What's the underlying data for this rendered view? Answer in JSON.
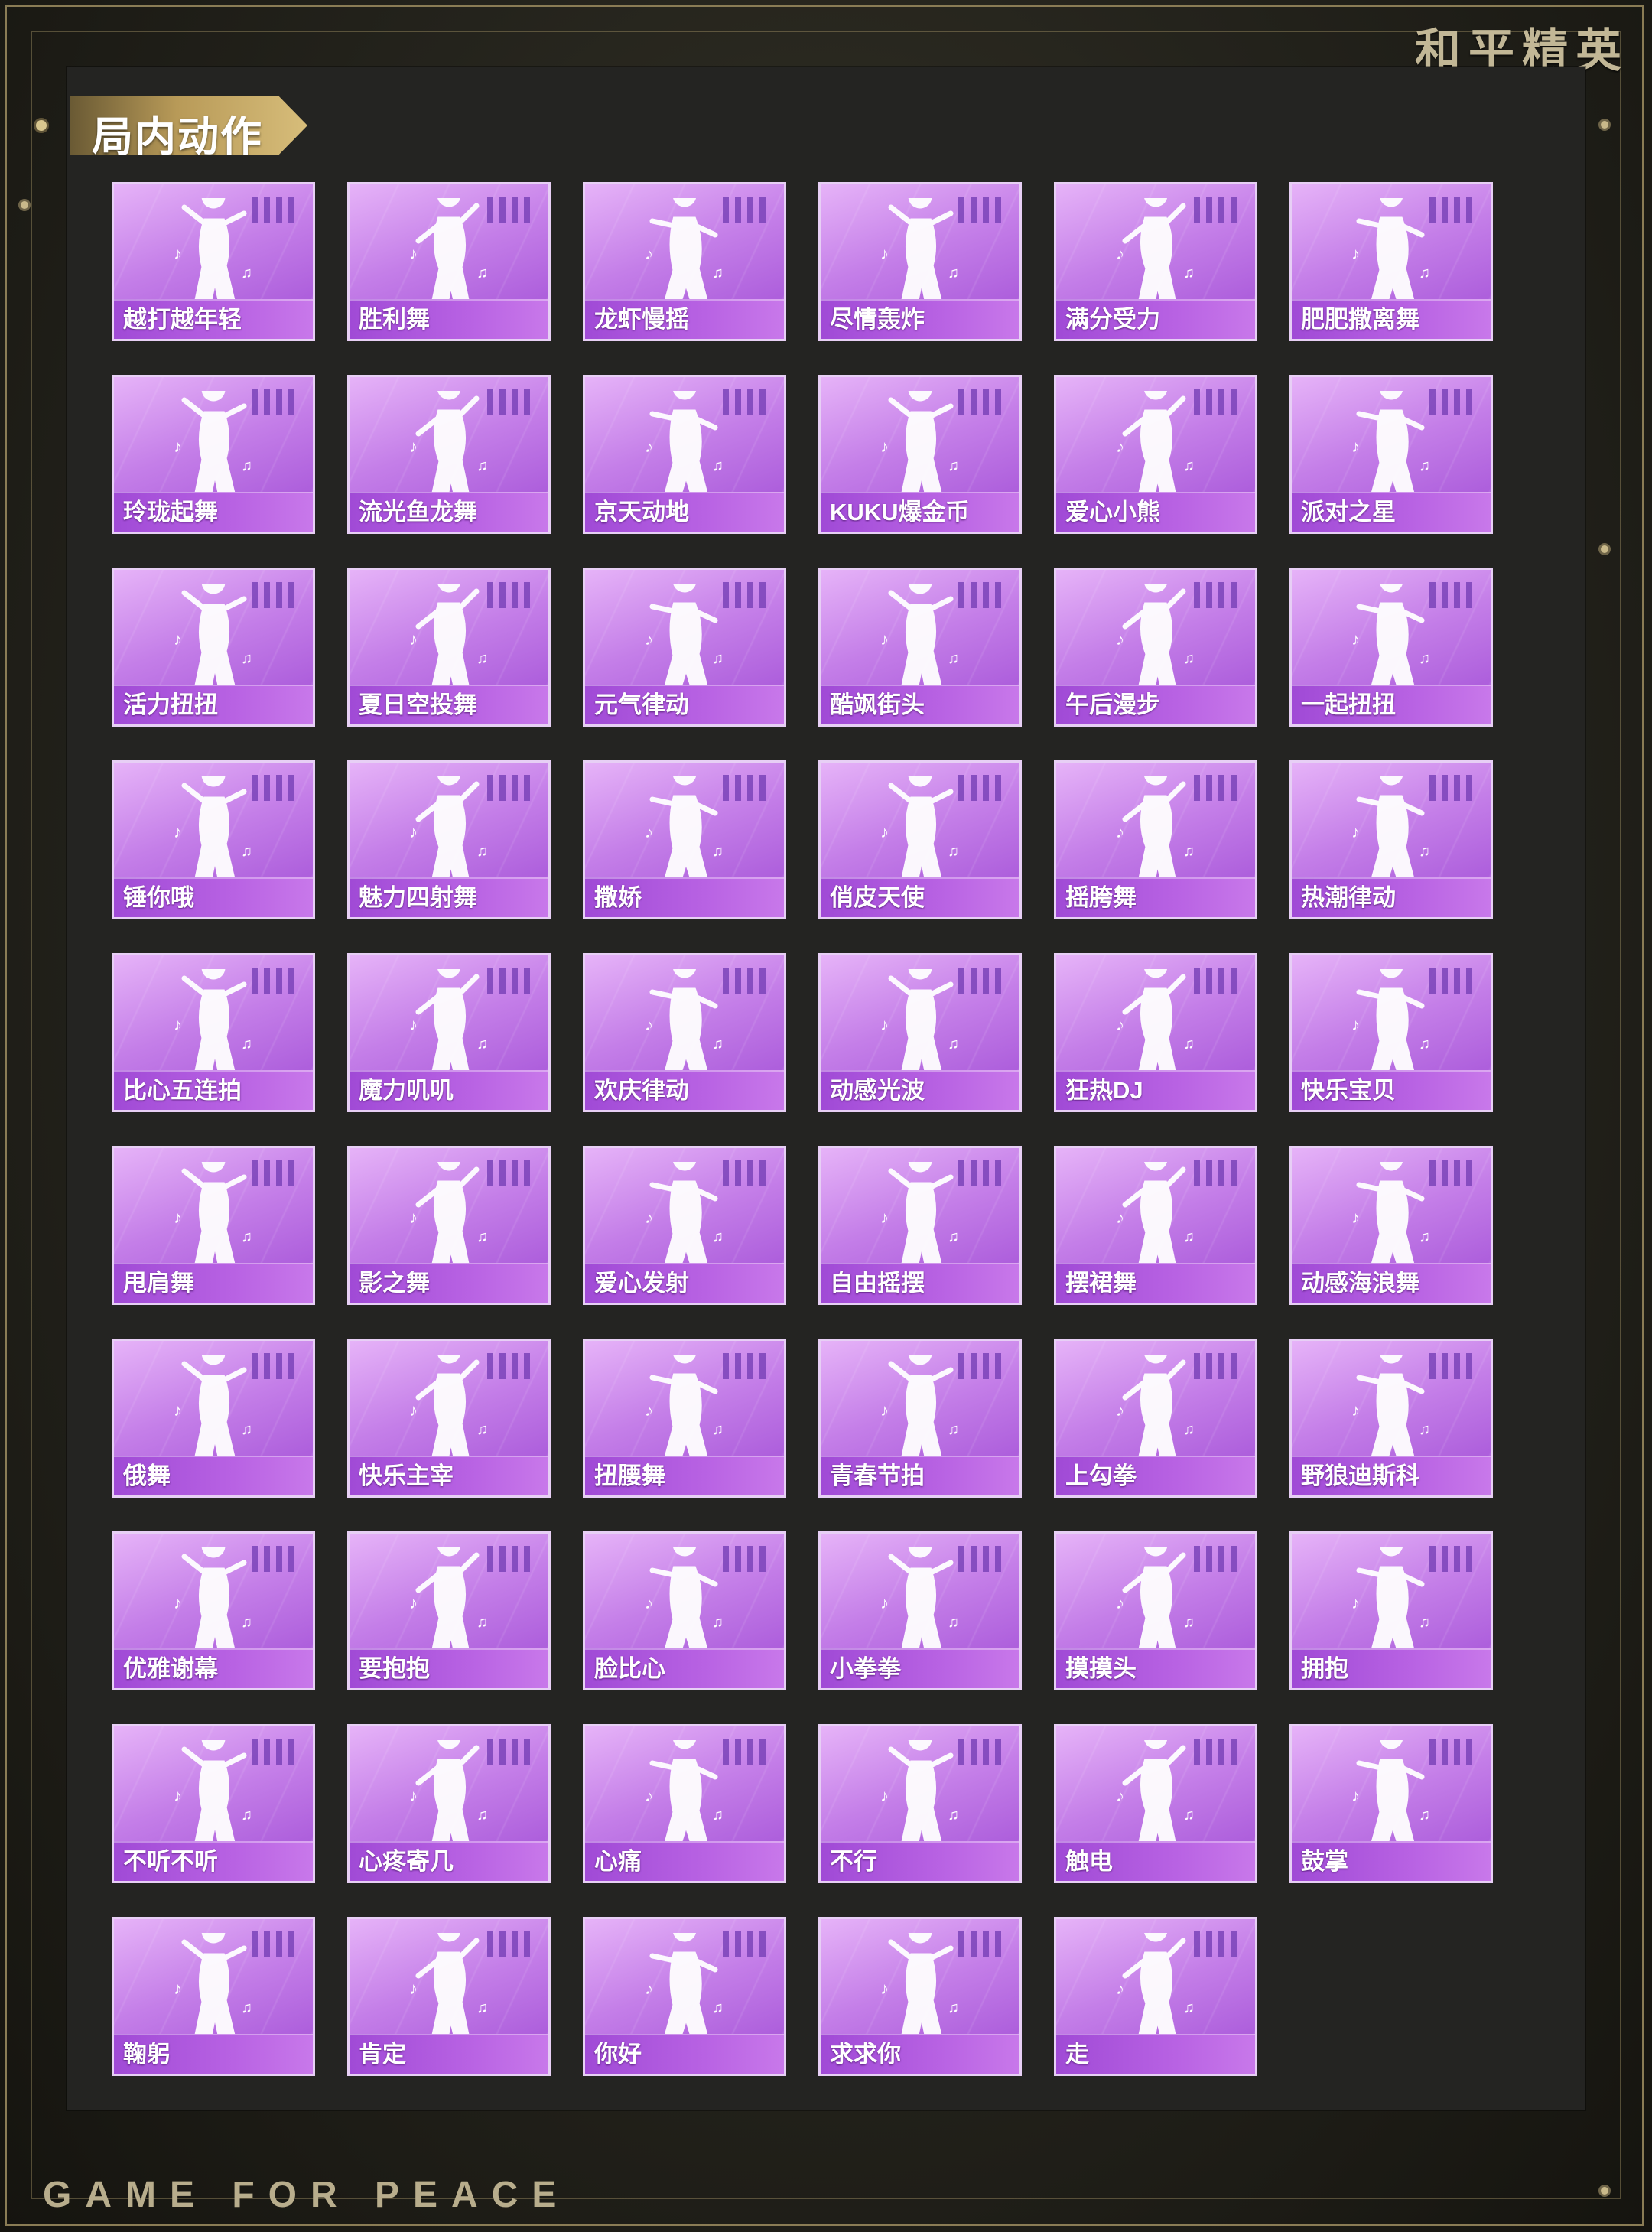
{
  "brand": {
    "top_text": "和平精英",
    "bottom_text": "GAME FOR PEACE"
  },
  "section": {
    "title": "局内动作"
  },
  "emotes": [
    {
      "name": "越打越年轻"
    },
    {
      "name": "胜利舞"
    },
    {
      "name": "龙虾慢摇"
    },
    {
      "name": "尽情轰炸"
    },
    {
      "name": "满分受力"
    },
    {
      "name": "肥肥撒离舞"
    },
    {
      "name": "玲珑起舞"
    },
    {
      "name": "流光鱼龙舞"
    },
    {
      "name": "京天动地"
    },
    {
      "name": "KUKU爆金币"
    },
    {
      "name": "爱心小熊"
    },
    {
      "name": "派对之星"
    },
    {
      "name": "活力扭扭"
    },
    {
      "name": "夏日空投舞"
    },
    {
      "name": "元气律动"
    },
    {
      "name": "酷飒街头"
    },
    {
      "name": "午后漫步"
    },
    {
      "name": "一起扭扭"
    },
    {
      "name": "锤你哦"
    },
    {
      "name": "魅力四射舞"
    },
    {
      "name": "撒娇"
    },
    {
      "name": "俏皮天使"
    },
    {
      "name": "摇胯舞"
    },
    {
      "name": "热潮律动"
    },
    {
      "name": "比心五连拍"
    },
    {
      "name": "魔力叽叽"
    },
    {
      "name": "欢庆律动"
    },
    {
      "name": "动感光波"
    },
    {
      "name": "狂热DJ"
    },
    {
      "name": "快乐宝贝"
    },
    {
      "name": "甩肩舞"
    },
    {
      "name": "影之舞"
    },
    {
      "name": "爱心发射"
    },
    {
      "name": "自由摇摆"
    },
    {
      "name": "摆裙舞"
    },
    {
      "name": "动感海浪舞"
    },
    {
      "name": "俄舞"
    },
    {
      "name": "快乐主宰"
    },
    {
      "name": "扭腰舞"
    },
    {
      "name": "青春节拍"
    },
    {
      "name": "上勾拳"
    },
    {
      "name": "野狼迪斯科"
    },
    {
      "name": "优雅谢幕"
    },
    {
      "name": "要抱抱"
    },
    {
      "name": "脸比心"
    },
    {
      "name": "小拳拳"
    },
    {
      "name": "摸摸头"
    },
    {
      "name": "拥抱"
    },
    {
      "name": "不听不听"
    },
    {
      "name": "心疼寄几"
    },
    {
      "name": "心痛"
    },
    {
      "name": "不行"
    },
    {
      "name": "触电"
    },
    {
      "name": "鼓掌"
    },
    {
      "name": "鞠躬"
    },
    {
      "name": "肯定"
    },
    {
      "name": "你好"
    },
    {
      "name": "求求你"
    },
    {
      "name": "走"
    }
  ],
  "icons": {
    "tile_figure": "dancer-silhouette-icon",
    "tile_bars": "rarity-bars-icon"
  },
  "colors": {
    "tile_gradient_start": "#e6b3f8",
    "tile_gradient_end": "#a24fd6",
    "label_gold": "#d7bd7a",
    "panel": "#242422"
  }
}
